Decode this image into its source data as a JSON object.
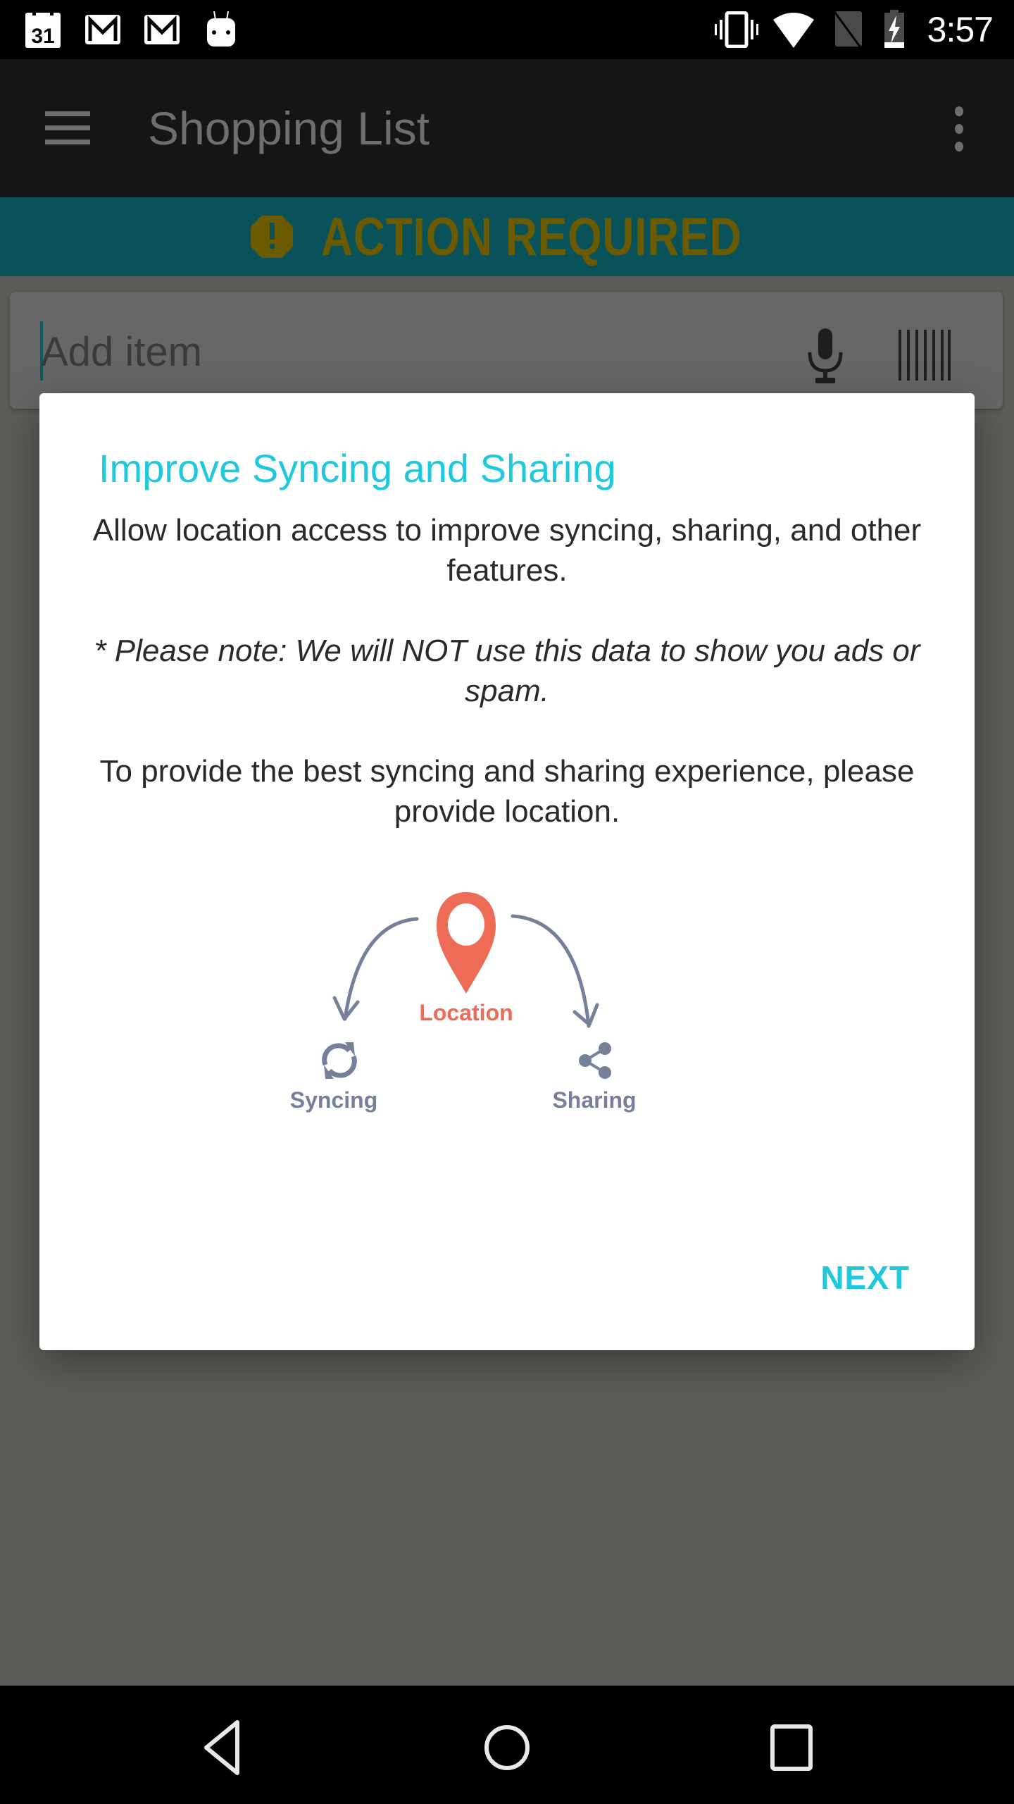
{
  "status_bar": {
    "time": "3:57",
    "notification_icons": [
      "calendar-icon",
      "gmail-icon",
      "gmail-icon",
      "android-icon"
    ],
    "calendar_day": "31",
    "system_icons": [
      "vibrate-icon",
      "wifi-icon",
      "no-signal-icon",
      "battery-charging-icon"
    ]
  },
  "app_bar": {
    "title": "Shopping List",
    "menu_icon": "hamburger-menu-icon",
    "overflow_icon": "more-vert-icon"
  },
  "banner": {
    "text": "ACTION REQUIRED",
    "icon": "alert-octagon-icon",
    "background": "#0a5259",
    "text_color": "#6b5a00"
  },
  "add_item": {
    "placeholder": "Add item",
    "value": "",
    "mic_icon": "microphone-icon",
    "barcode_icon": "barcode-icon"
  },
  "dialog": {
    "title": "Improve Syncing and Sharing",
    "paragraph1": "Allow location access to improve syncing, sharing, and other features.",
    "note": "* Please note: We will NOT use this data to show you ads or spam.",
    "paragraph2": "To provide the best syncing and sharing experience, please provide location.",
    "diagram": {
      "center_label": "Location",
      "left_label": "Syncing",
      "right_label": "Sharing",
      "accent_color": "#ee6c55",
      "secondary_color": "#75809a"
    },
    "next_label": "NEXT",
    "accent_color": "#1ec8dd"
  },
  "nav_bar": {
    "back": "back-icon",
    "home": "home-icon",
    "recents": "recents-icon"
  }
}
